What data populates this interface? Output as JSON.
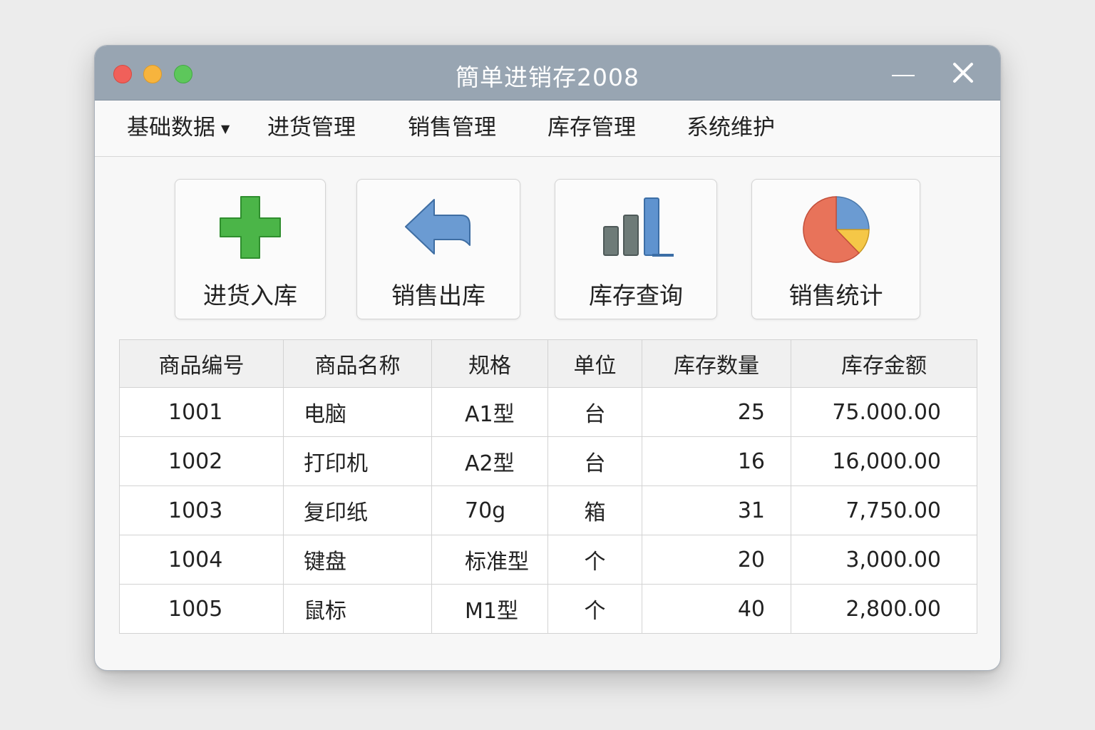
{
  "window": {
    "title": "簡单进销存2008"
  },
  "menu": [
    {
      "label": "基础数据",
      "has_dropdown": true
    },
    {
      "label": "进货管理"
    },
    {
      "label": "销售管理"
    },
    {
      "label": "库存管理"
    },
    {
      "label": "系统维护"
    }
  ],
  "toolbar": [
    {
      "label": "进货入库",
      "icon": "plus-icon",
      "color": "#4bb548"
    },
    {
      "label": "销售出库",
      "icon": "back-arrow-icon",
      "color": "#6b9bd2"
    },
    {
      "label": "库存查询",
      "icon": "bar-chart-icon",
      "color": "#6e7b78"
    },
    {
      "label": "销售统计",
      "icon": "pie-chart-icon",
      "color": "#e8735a"
    }
  ],
  "table": {
    "headers": [
      "商品编号",
      "商品名称",
      "规格",
      "单位",
      "库存数量",
      "库存金额"
    ],
    "rows": [
      [
        "1001",
        "电脑",
        "A1型",
        "台",
        "25",
        "75.000.00"
      ],
      [
        "1002",
        "打印机",
        "A2型",
        "台",
        "16",
        "16,000.00"
      ],
      [
        "1003",
        "复印纸",
        "70g",
        "箱",
        "31",
        "7,750.00"
      ],
      [
        "1004",
        "键盘",
        "标准型",
        "个",
        "20",
        "3,000.00"
      ],
      [
        "1005",
        "鼠标",
        "M1型",
        "个",
        "40",
        "2,800.00"
      ]
    ]
  },
  "colors": {
    "titlebar": "#98a5b2",
    "traffic_red": "#f0605a",
    "traffic_yellow": "#f7b43d",
    "traffic_green": "#5dc75b"
  }
}
